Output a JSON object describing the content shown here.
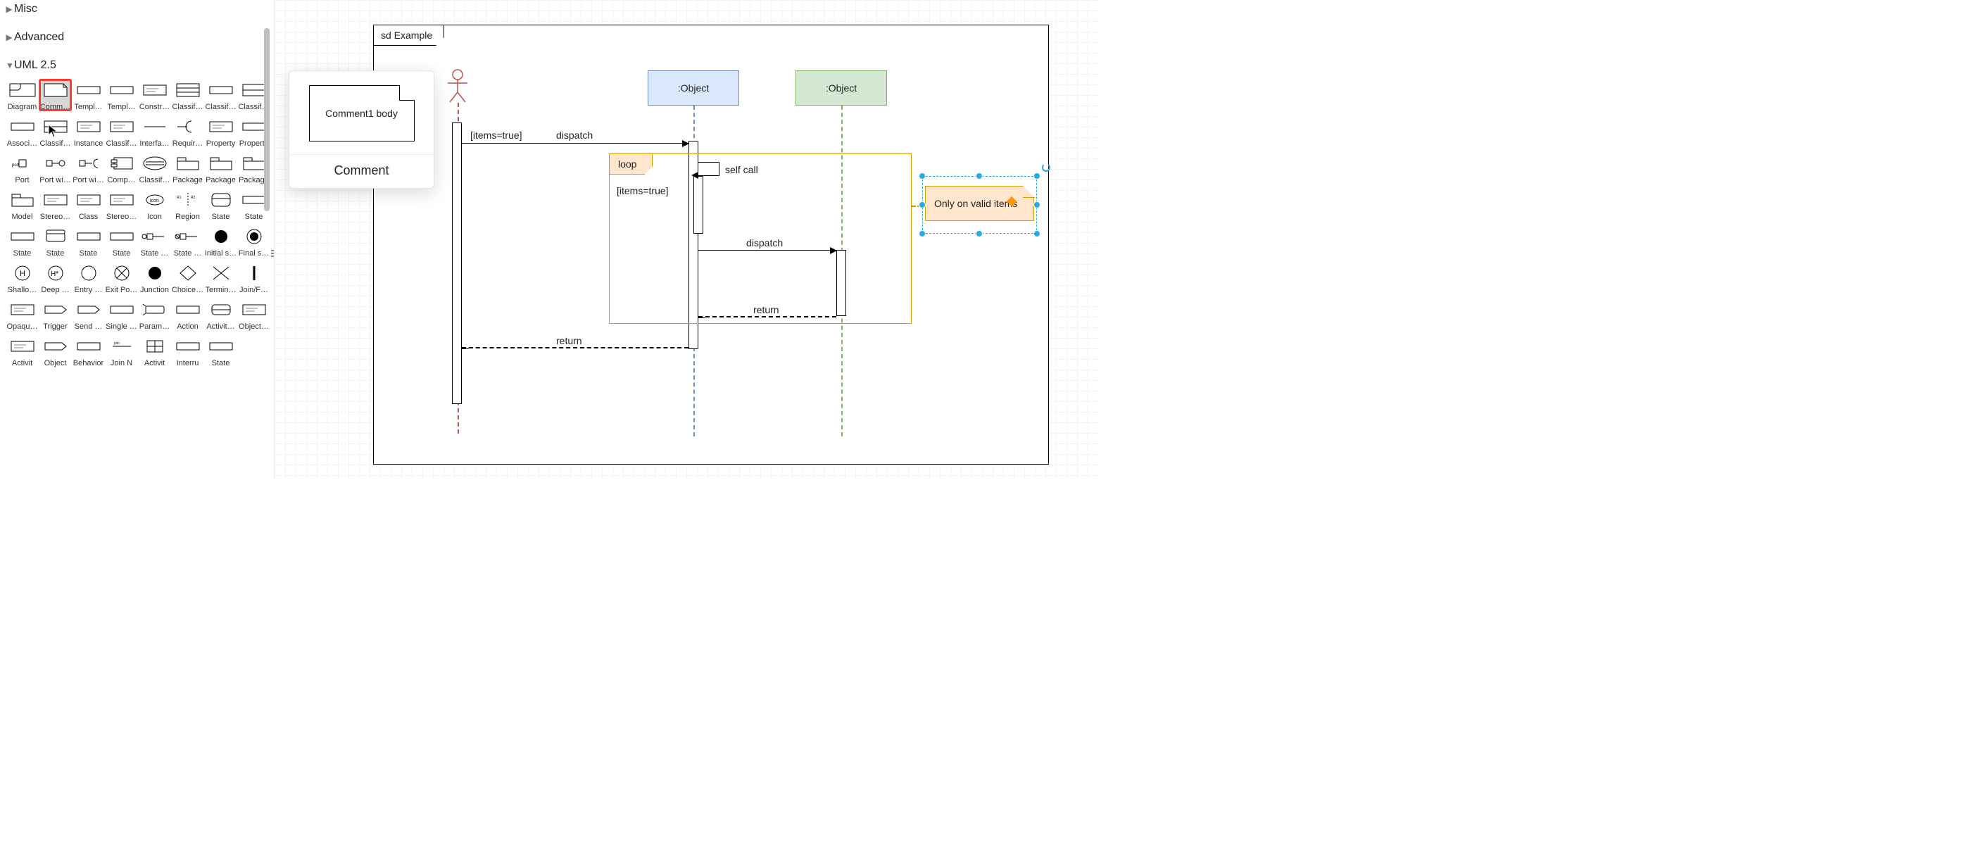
{
  "sidebar": {
    "sections": [
      {
        "label": "Misc",
        "expanded": false
      },
      {
        "label": "Advanced",
        "expanded": false
      },
      {
        "label": "UML 2.5",
        "expanded": true
      }
    ],
    "shapes": [
      {
        "label": "Diagram",
        "icon": "frame"
      },
      {
        "label": "Comm…",
        "icon": "note",
        "highlight": true
      },
      {
        "label": "Templ…",
        "icon": "rect-line"
      },
      {
        "label": "Templ…",
        "icon": "rect-line"
      },
      {
        "label": "Constr…",
        "icon": "rect-text"
      },
      {
        "label": "Classif…",
        "icon": "rect-3"
      },
      {
        "label": "Classif…",
        "icon": "rect-line"
      },
      {
        "label": "Classif…",
        "icon": "rect-2"
      },
      {
        "label": "Associ…",
        "icon": "rect-line"
      },
      {
        "label": "Classif…",
        "icon": "rect-2"
      },
      {
        "label": "Instance",
        "icon": "rect-text"
      },
      {
        "label": "Classif…",
        "icon": "rect-text"
      },
      {
        "label": "Interfa…",
        "icon": "line"
      },
      {
        "label": "Requir…",
        "icon": "half-circle"
      },
      {
        "label": "Property",
        "icon": "rect-text"
      },
      {
        "label": "Property",
        "icon": "rect-line"
      },
      {
        "label": "Port",
        "icon": "port"
      },
      {
        "label": "Port wi…",
        "icon": "port-prov"
      },
      {
        "label": "Port wi…",
        "icon": "port-req"
      },
      {
        "label": "Comp…",
        "icon": "component"
      },
      {
        "label": "Classif…",
        "icon": "ellipse-bars"
      },
      {
        "label": "Package",
        "icon": "package"
      },
      {
        "label": "Package",
        "icon": "package"
      },
      {
        "label": "Package",
        "icon": "package"
      },
      {
        "label": "Model",
        "icon": "package"
      },
      {
        "label": "Stereo…",
        "icon": "rect-text"
      },
      {
        "label": "Class",
        "icon": "rect-text"
      },
      {
        "label": "Stereo…",
        "icon": "rect-text"
      },
      {
        "label": "Icon",
        "icon": "ellipse-sm"
      },
      {
        "label": "Region",
        "icon": "region"
      },
      {
        "label": "State",
        "icon": "state-round"
      },
      {
        "label": "State",
        "icon": "rect-line"
      },
      {
        "label": "State",
        "icon": "rect-line"
      },
      {
        "label": "State",
        "icon": "state-tab"
      },
      {
        "label": "State",
        "icon": "rect-line"
      },
      {
        "label": "State",
        "icon": "rect-line"
      },
      {
        "label": "State …",
        "icon": "entry"
      },
      {
        "label": "State …",
        "icon": "exit"
      },
      {
        "label": "Initial s…",
        "icon": "solid-circle"
      },
      {
        "label": "Final s…",
        "icon": "final"
      },
      {
        "label": "Shallo…",
        "icon": "h"
      },
      {
        "label": "Deep …",
        "icon": "h-star"
      },
      {
        "label": "Entry …",
        "icon": "open-circle"
      },
      {
        "label": "Exit Po…",
        "icon": "circle-x"
      },
      {
        "label": "Junction",
        "icon": "solid-circle"
      },
      {
        "label": "Choice…",
        "icon": "diamond"
      },
      {
        "label": "Termin…",
        "icon": "x"
      },
      {
        "label": "Join/F…",
        "icon": "bar"
      },
      {
        "label": "Opaqu…",
        "icon": "rect-text"
      },
      {
        "label": "Trigger",
        "icon": "flag-r"
      },
      {
        "label": "Send …",
        "icon": "flag-r"
      },
      {
        "label": "Single …",
        "icon": "rect-line"
      },
      {
        "label": "Param…",
        "icon": "param"
      },
      {
        "label": "Action",
        "icon": "rect-line"
      },
      {
        "label": "Activit…",
        "icon": "activity"
      },
      {
        "label": "Object…",
        "icon": "rect-text"
      },
      {
        "label": "Activit",
        "icon": "rect-text"
      },
      {
        "label": "Object",
        "icon": "flag-r"
      },
      {
        "label": "Behavior",
        "icon": "rect-line"
      },
      {
        "label": "Join N",
        "icon": "line-text"
      },
      {
        "label": "Activit",
        "icon": "grid4"
      },
      {
        "label": "Interru",
        "icon": "rect-line"
      },
      {
        "label": "State",
        "icon": "rect-line"
      }
    ]
  },
  "preview": {
    "body": "Comment1 body",
    "caption": "Comment"
  },
  "diagram": {
    "frame_label": "sd Example",
    "lifelines": {
      "actor": {
        "type": "actor"
      },
      "obj1": {
        "head": ":Object",
        "style": "obj-blue",
        "dash": "ll-blue"
      },
      "obj2": {
        "head": ":Object",
        "style": "obj-green",
        "dash": "ll-green"
      }
    },
    "loop": {
      "tag": "loop",
      "guard": "[items=true]"
    },
    "messages": {
      "dispatch1_guard": "[items=true]",
      "dispatch1": "dispatch",
      "selfcall": "self call",
      "dispatch2": "dispatch",
      "return1": "return",
      "return2": "return"
    },
    "note": "Only on valid items"
  }
}
